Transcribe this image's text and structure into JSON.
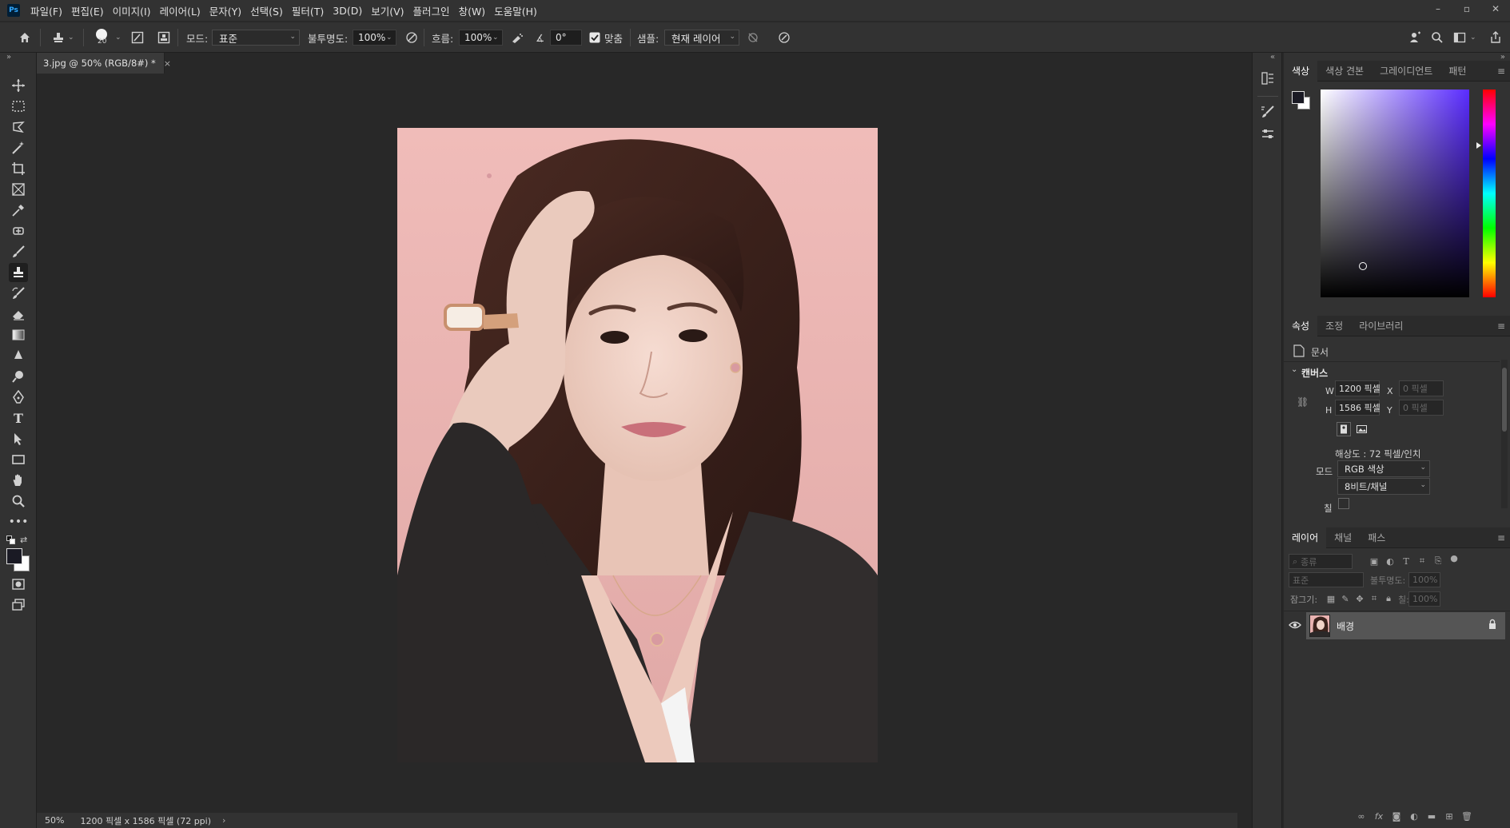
{
  "app": {
    "logo": "Ps"
  },
  "menu": [
    "파일(F)",
    "편집(E)",
    "이미지(I)",
    "레이어(L)",
    "문자(Y)",
    "선택(S)",
    "필터(T)",
    "3D(D)",
    "보기(V)",
    "플러그인",
    "창(W)",
    "도움말(H)"
  ],
  "window_controls": {
    "minimize": "–",
    "maximize": "▫",
    "close": "✕"
  },
  "options": {
    "brush_size": "20",
    "mode_label": "모드:",
    "mode_value": "표준",
    "opacity_label": "불투명도:",
    "opacity_value": "100%",
    "flow_label": "흐름:",
    "flow_value": "100%",
    "angle_value": "0°",
    "aligned_label": "맞춤",
    "sample_label": "샘플:",
    "sample_value": "현재 레이어"
  },
  "document": {
    "tab_title": "3.jpg @ 50% (RGB/8#) *",
    "tab_close": "×"
  },
  "status": {
    "zoom": "50%",
    "info": "1200 픽셀 x 1586 픽셀 (72 ppi)",
    "arrow": "›"
  },
  "color_panel": {
    "tabs": [
      "색상",
      "색상 견본",
      "그레이디언트",
      "패턴"
    ],
    "foreground": "#1a1a24",
    "background": "#ffffff",
    "hue": "#5a2cff"
  },
  "properties_panel": {
    "tabs": [
      "속성",
      "조정",
      "라이브러리"
    ],
    "type_label": "문서",
    "section_title": "캔버스",
    "w_label": "W",
    "w_value": "1200 픽셀",
    "h_label": "H",
    "h_value": "1586 픽셀",
    "x_label": "X",
    "x_value": "0 픽셀",
    "y_label": "Y",
    "y_value": "0 픽셀",
    "resolution": "해상도 : 72 픽셀/인치",
    "mode_label": "모드",
    "mode_value": "RGB 색상",
    "bits_value": "8비트/채널",
    "fill_label": "칠"
  },
  "layers_panel": {
    "tabs": [
      "레이어",
      "채널",
      "패스"
    ],
    "filter_placeholder": "종류",
    "blend_mode": "표준",
    "opacity_label": "불투명도:",
    "opacity_value": "100%",
    "lock_label": "잠그기:",
    "fill_label": "칠:",
    "fill_value": "100%",
    "layers": [
      {
        "name": "배경",
        "visible": true,
        "locked": true
      }
    ]
  }
}
